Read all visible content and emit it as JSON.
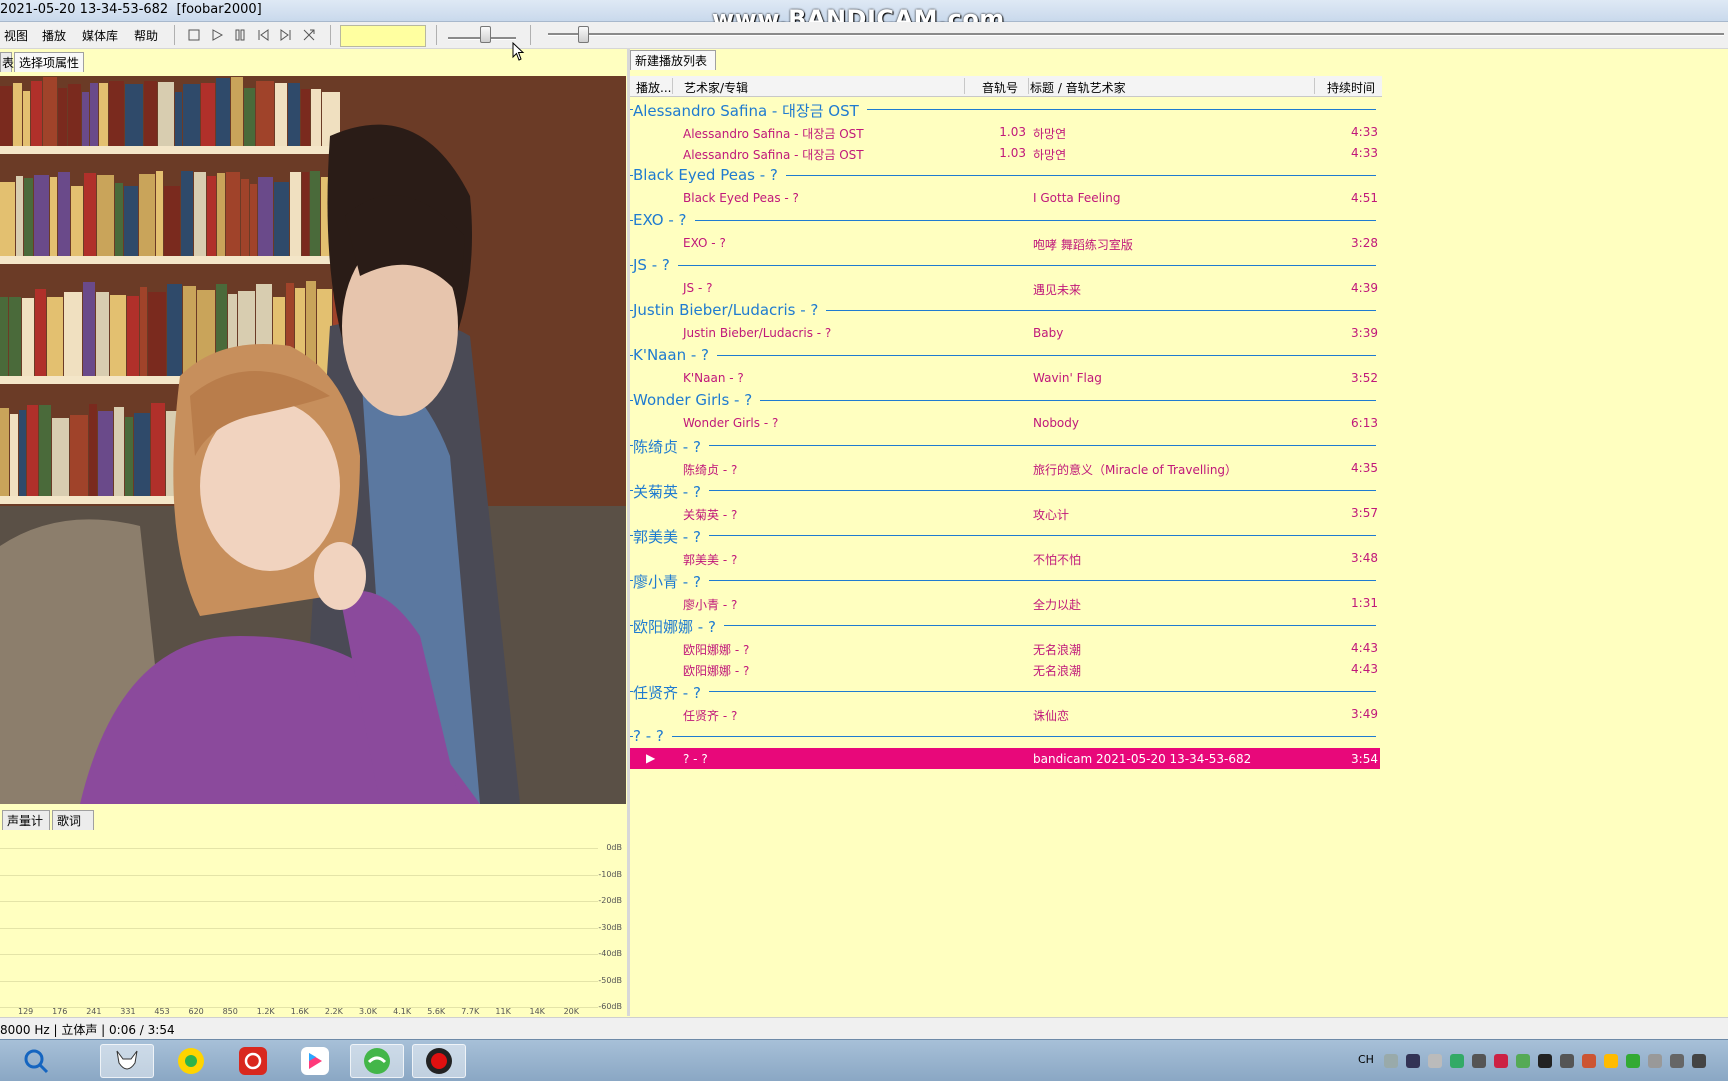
{
  "window": {
    "title": "2021-05-20 13-34-53-682  [foobar2000]",
    "watermark": "www.BANDICAM.com"
  },
  "menu": {
    "items": [
      "视图",
      "播放",
      "媒体库",
      "帮助"
    ]
  },
  "toolbar": {
    "buttons": [
      "stop-icon",
      "play-icon",
      "pause-icon",
      "previous-icon",
      "next-icon",
      "random-icon"
    ],
    "volume_level": 0.55,
    "seek_position": 0.03
  },
  "left_panel": {
    "tabs": [
      "表",
      "选择项属性"
    ],
    "bottom_tabs": [
      "声量计",
      "歌词"
    ]
  },
  "spectrum": {
    "db_labels": [
      "0dB",
      "-10dB",
      "-20dB",
      "-30dB",
      "-40dB",
      "-50dB",
      "-60dB"
    ],
    "freq_labels": [
      "129",
      "176",
      "241",
      "331",
      "453",
      "620",
      "850",
      "1.2K",
      "1.6K",
      "2.2K",
      "3.0K",
      "4.1K",
      "5.6K",
      "7.7K",
      "11K",
      "14K",
      "20K"
    ]
  },
  "playlist": {
    "tab": "新建播放列表",
    "columns": {
      "playing": "播放...",
      "artist_album": "艺术家/专辑",
      "track_no": "音轨号",
      "title_artist": "标题 / 音轨艺术家",
      "duration": "持续时间"
    },
    "groups": [
      {
        "title": "Alessandro Safina - 대장금 OST",
        "tracks": [
          {
            "artist": "Alessandro Safina - 대장금 OST",
            "num": "1.03",
            "title": "하망연",
            "dur": "4:33"
          },
          {
            "artist": "Alessandro Safina - 대장금 OST",
            "num": "1.03",
            "title": "하망연",
            "dur": "4:33"
          }
        ]
      },
      {
        "title": "Black Eyed Peas - ?",
        "tracks": [
          {
            "artist": "Black Eyed Peas - ?",
            "num": "",
            "title": "I Gotta Feeling",
            "dur": "4:51"
          }
        ]
      },
      {
        "title": "EXO - ?",
        "tracks": [
          {
            "artist": "EXO - ?",
            "num": "",
            "title": "咆哮 舞蹈练习室版",
            "dur": "3:28"
          }
        ]
      },
      {
        "title": "JS - ?",
        "tracks": [
          {
            "artist": "JS - ?",
            "num": "",
            "title": "遇见未来",
            "dur": "4:39"
          }
        ]
      },
      {
        "title": "Justin Bieber/Ludacris - ?",
        "tracks": [
          {
            "artist": "Justin Bieber/Ludacris - ?",
            "num": "",
            "title": "Baby",
            "dur": "3:39"
          }
        ]
      },
      {
        "title": "K'Naan - ?",
        "tracks": [
          {
            "artist": "K'Naan - ?",
            "num": "",
            "title": "Wavin' Flag",
            "dur": "3:52"
          }
        ]
      },
      {
        "title": "Wonder Girls - ?",
        "tracks": [
          {
            "artist": "Wonder Girls - ?",
            "num": "",
            "title": "Nobody",
            "dur": "6:13"
          }
        ]
      },
      {
        "title": "陈绮贞 - ?",
        "tracks": [
          {
            "artist": "陈绮贞 - ?",
            "num": "",
            "title": "旅行的意义（Miracle of Travelling）",
            "dur": "4:35"
          }
        ]
      },
      {
        "title": "关菊英 - ?",
        "tracks": [
          {
            "artist": "关菊英 - ?",
            "num": "",
            "title": "攻心计",
            "dur": "3:57"
          }
        ]
      },
      {
        "title": "郭美美 - ?",
        "tracks": [
          {
            "artist": "郭美美 - ?",
            "num": "",
            "title": "不怕不怕",
            "dur": "3:48"
          }
        ]
      },
      {
        "title": "廖小青 - ?",
        "tracks": [
          {
            "artist": "廖小青 - ?",
            "num": "",
            "title": "全力以赴",
            "dur": "1:31"
          }
        ]
      },
      {
        "title": "欧阳娜娜 - ?",
        "tracks": [
          {
            "artist": "欧阳娜娜 - ?",
            "num": "",
            "title": "无名浪潮",
            "dur": "4:43"
          },
          {
            "artist": "欧阳娜娜 - ?",
            "num": "",
            "title": "无名浪潮",
            "dur": "4:43"
          }
        ]
      },
      {
        "title": "任贤齐 - ?",
        "tracks": [
          {
            "artist": "任贤齐 - ?",
            "num": "",
            "title": "诛仙恋",
            "dur": "3:49"
          }
        ]
      },
      {
        "title": "? - ?",
        "tracks": [
          {
            "artist": "? - ?",
            "num": "",
            "title": "bandicam 2021-05-20 13-34-53-682",
            "dur": "3:54",
            "playing": true
          }
        ]
      }
    ]
  },
  "status": {
    "text": "8000 Hz | 立体声 | 0:06 / 3:54"
  },
  "taskbar": {
    "apps": [
      "search-app-icon",
      "foobar2000-app-icon",
      "qq-music-app-icon",
      "netease-music-app-icon",
      "youku-app-icon",
      "browser-app-icon",
      "bandicam-app-icon"
    ],
    "tray_label": "CH"
  },
  "colors": {
    "background": "#ffffc0",
    "group": "#1f7bd0",
    "track": "#c0187a",
    "playing_row": "#e8087a"
  }
}
